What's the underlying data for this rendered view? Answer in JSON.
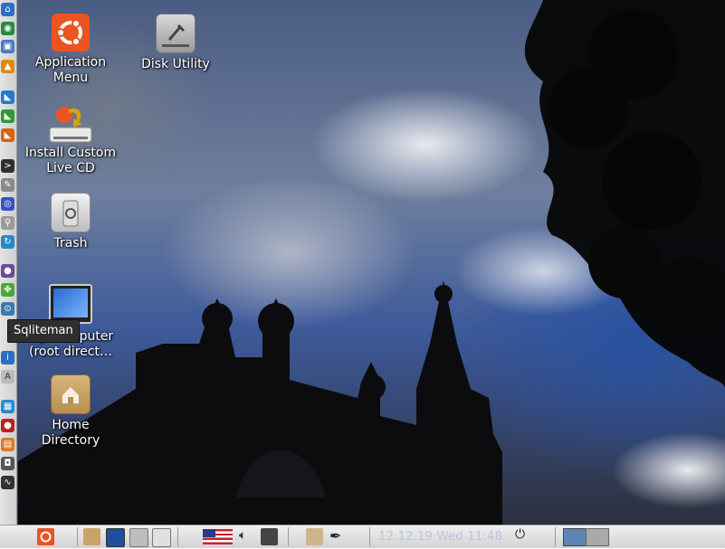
{
  "desktop": {
    "icons": [
      {
        "name": "application-menu",
        "label": "Application Menu"
      },
      {
        "name": "disk-utility",
        "label": "Disk Utility"
      },
      {
        "name": "install-custom-live-cd",
        "label": "Install Custom Live CD"
      },
      {
        "name": "trash",
        "label": "Trash"
      },
      {
        "name": "computer",
        "label": "My Computer (root direct…"
      },
      {
        "name": "home-directory",
        "label": "Home Directory"
      }
    ]
  },
  "tooltip": {
    "text": "Sqliteman"
  },
  "panel": {
    "clock": "12.12.19 Wed 11:48"
  },
  "colors": {
    "ubuntu_orange": "#e95420",
    "launcher_bg": "#d8d8d8",
    "panel_bg": "#e0e0e0",
    "workspace_active": "#5b86b4",
    "workspace_inactive": "#a9a9a9"
  }
}
